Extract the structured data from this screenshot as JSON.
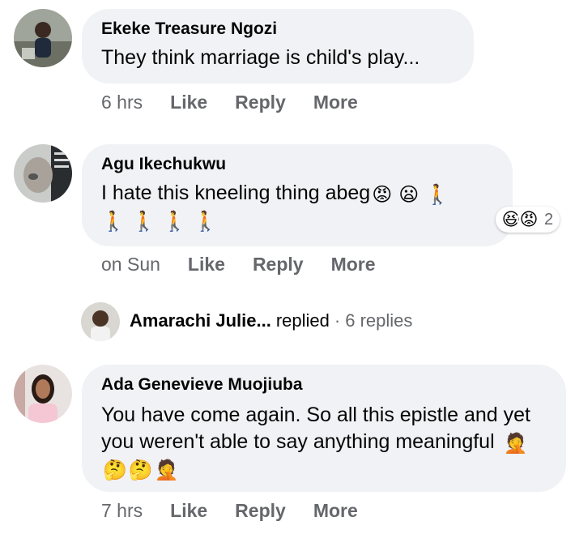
{
  "comments": [
    {
      "author": "Ekeke Treasure Ngozi",
      "text": "They think marriage is child's play...",
      "time": "6 hrs",
      "actions": {
        "like": "Like",
        "reply": "Reply",
        "more": "More"
      }
    },
    {
      "author": "Agu Ikechukwu",
      "text": "I hate this kneeling thing abeg",
      "emojis": [
        "😡",
        "😦",
        "🚶",
        "🚶",
        "🚶",
        "🚶",
        "🚶"
      ],
      "time": "on Sun",
      "actions": {
        "like": "Like",
        "reply": "Reply",
        "more": "More"
      },
      "reactions": {
        "icons": [
          "😆",
          "😡"
        ],
        "count": "2"
      }
    },
    {
      "author": "Ada Genevieve Muojiuba",
      "text": "You have come again. So all this epistle and yet you weren't able to say anything meaningful",
      "emojis": [
        "🤦",
        "🤔",
        "🤔",
        "🤦"
      ],
      "time": "7 hrs",
      "actions": {
        "like": "Like",
        "reply": "Reply",
        "more": "More"
      }
    }
  ],
  "reply_thread": {
    "name": "Amarachi Julie...",
    "verb": "replied",
    "separator": "·",
    "count": "6 replies"
  },
  "colors": {
    "bubble": "#f0f2f5",
    "meta_text": "#65676b",
    "primary_text": "#050505"
  }
}
